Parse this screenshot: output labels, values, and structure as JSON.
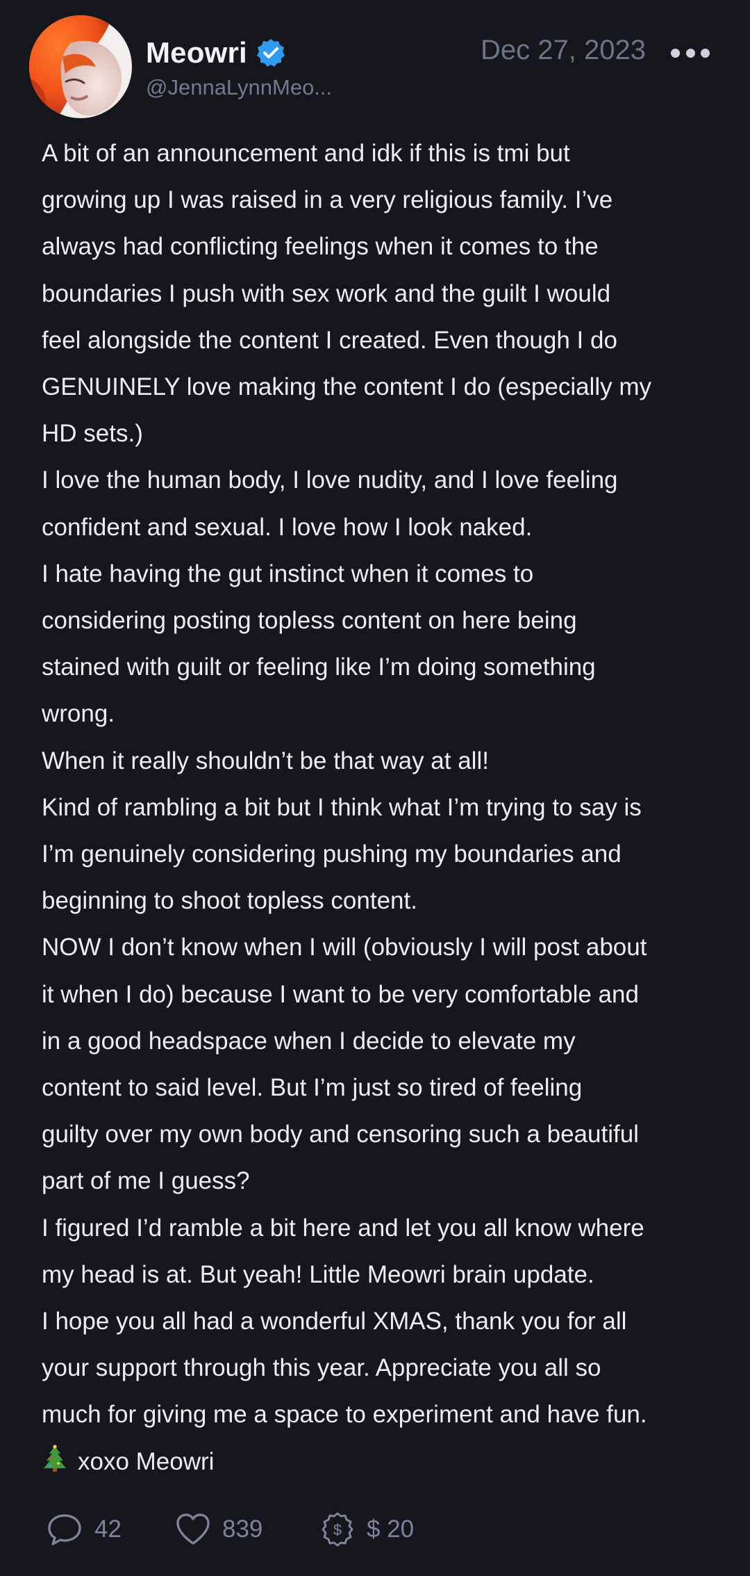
{
  "post": {
    "author": {
      "display_name": "Meowri",
      "handle": "@JennaLynnMeo...",
      "verified": true,
      "avatar": "profile-photo-orange-hair"
    },
    "date": "Dec 27, 2023",
    "more_icon": "more-dots-icon",
    "lines": [
      "A bit of an announcement and idk if this is tmi but",
      "growing up I was raised in a very religious family. I’ve",
      "always had conflicting feelings when it comes to the",
      "boundaries I push with sex work and the guilt I would",
      "feel alongside the content I created. Even though I do",
      "GENUINELY love making the content I do (especially my",
      "HD sets.)",
      "I love the human body, I love nudity, and I love feeling",
      "confident and sexual. I love how I look naked.",
      "I hate having the gut instinct when it comes to",
      "considering posting topless content on here being",
      "stained with guilt or feeling like I’m doing something",
      "wrong.",
      "When it really shouldn’t be that way at all!",
      "Kind of rambling a bit but I think what I’m trying to say is",
      "I’m genuinely considering pushing my boundaries and",
      "beginning to shoot topless content.",
      "NOW I don’t know when I will (obviously I will post about",
      "it when I do) because I want to be very comfortable and",
      "in a good headspace when I decide to elevate my",
      "content to said level. But I’m just so tired of feeling",
      "guilty over my own body and censoring such a beautiful",
      "part of me I guess?",
      "I figured I’d ramble a bit here and let you all know where",
      "my head is at. But yeah! Little Meowri brain update.",
      "I hope you all had a wonderful XMAS, thank you for all",
      "your support through this year. Appreciate you all so",
      "much for giving me a space to experiment and have fun."
    ],
    "signoff": {
      "emoji_icon": "christmas-tree-icon",
      "text": "xoxo Meowri"
    },
    "actions": {
      "comments": {
        "icon": "comment-icon",
        "count": "42"
      },
      "likes": {
        "icon": "heart-icon",
        "count": "839"
      },
      "tips": {
        "icon": "tip-dollar-icon",
        "amount": "$ 20"
      }
    },
    "colors": {
      "background": "#16171c",
      "text": "#eceef3",
      "muted": "#7d849a",
      "verified": "#2f9bf0"
    }
  }
}
